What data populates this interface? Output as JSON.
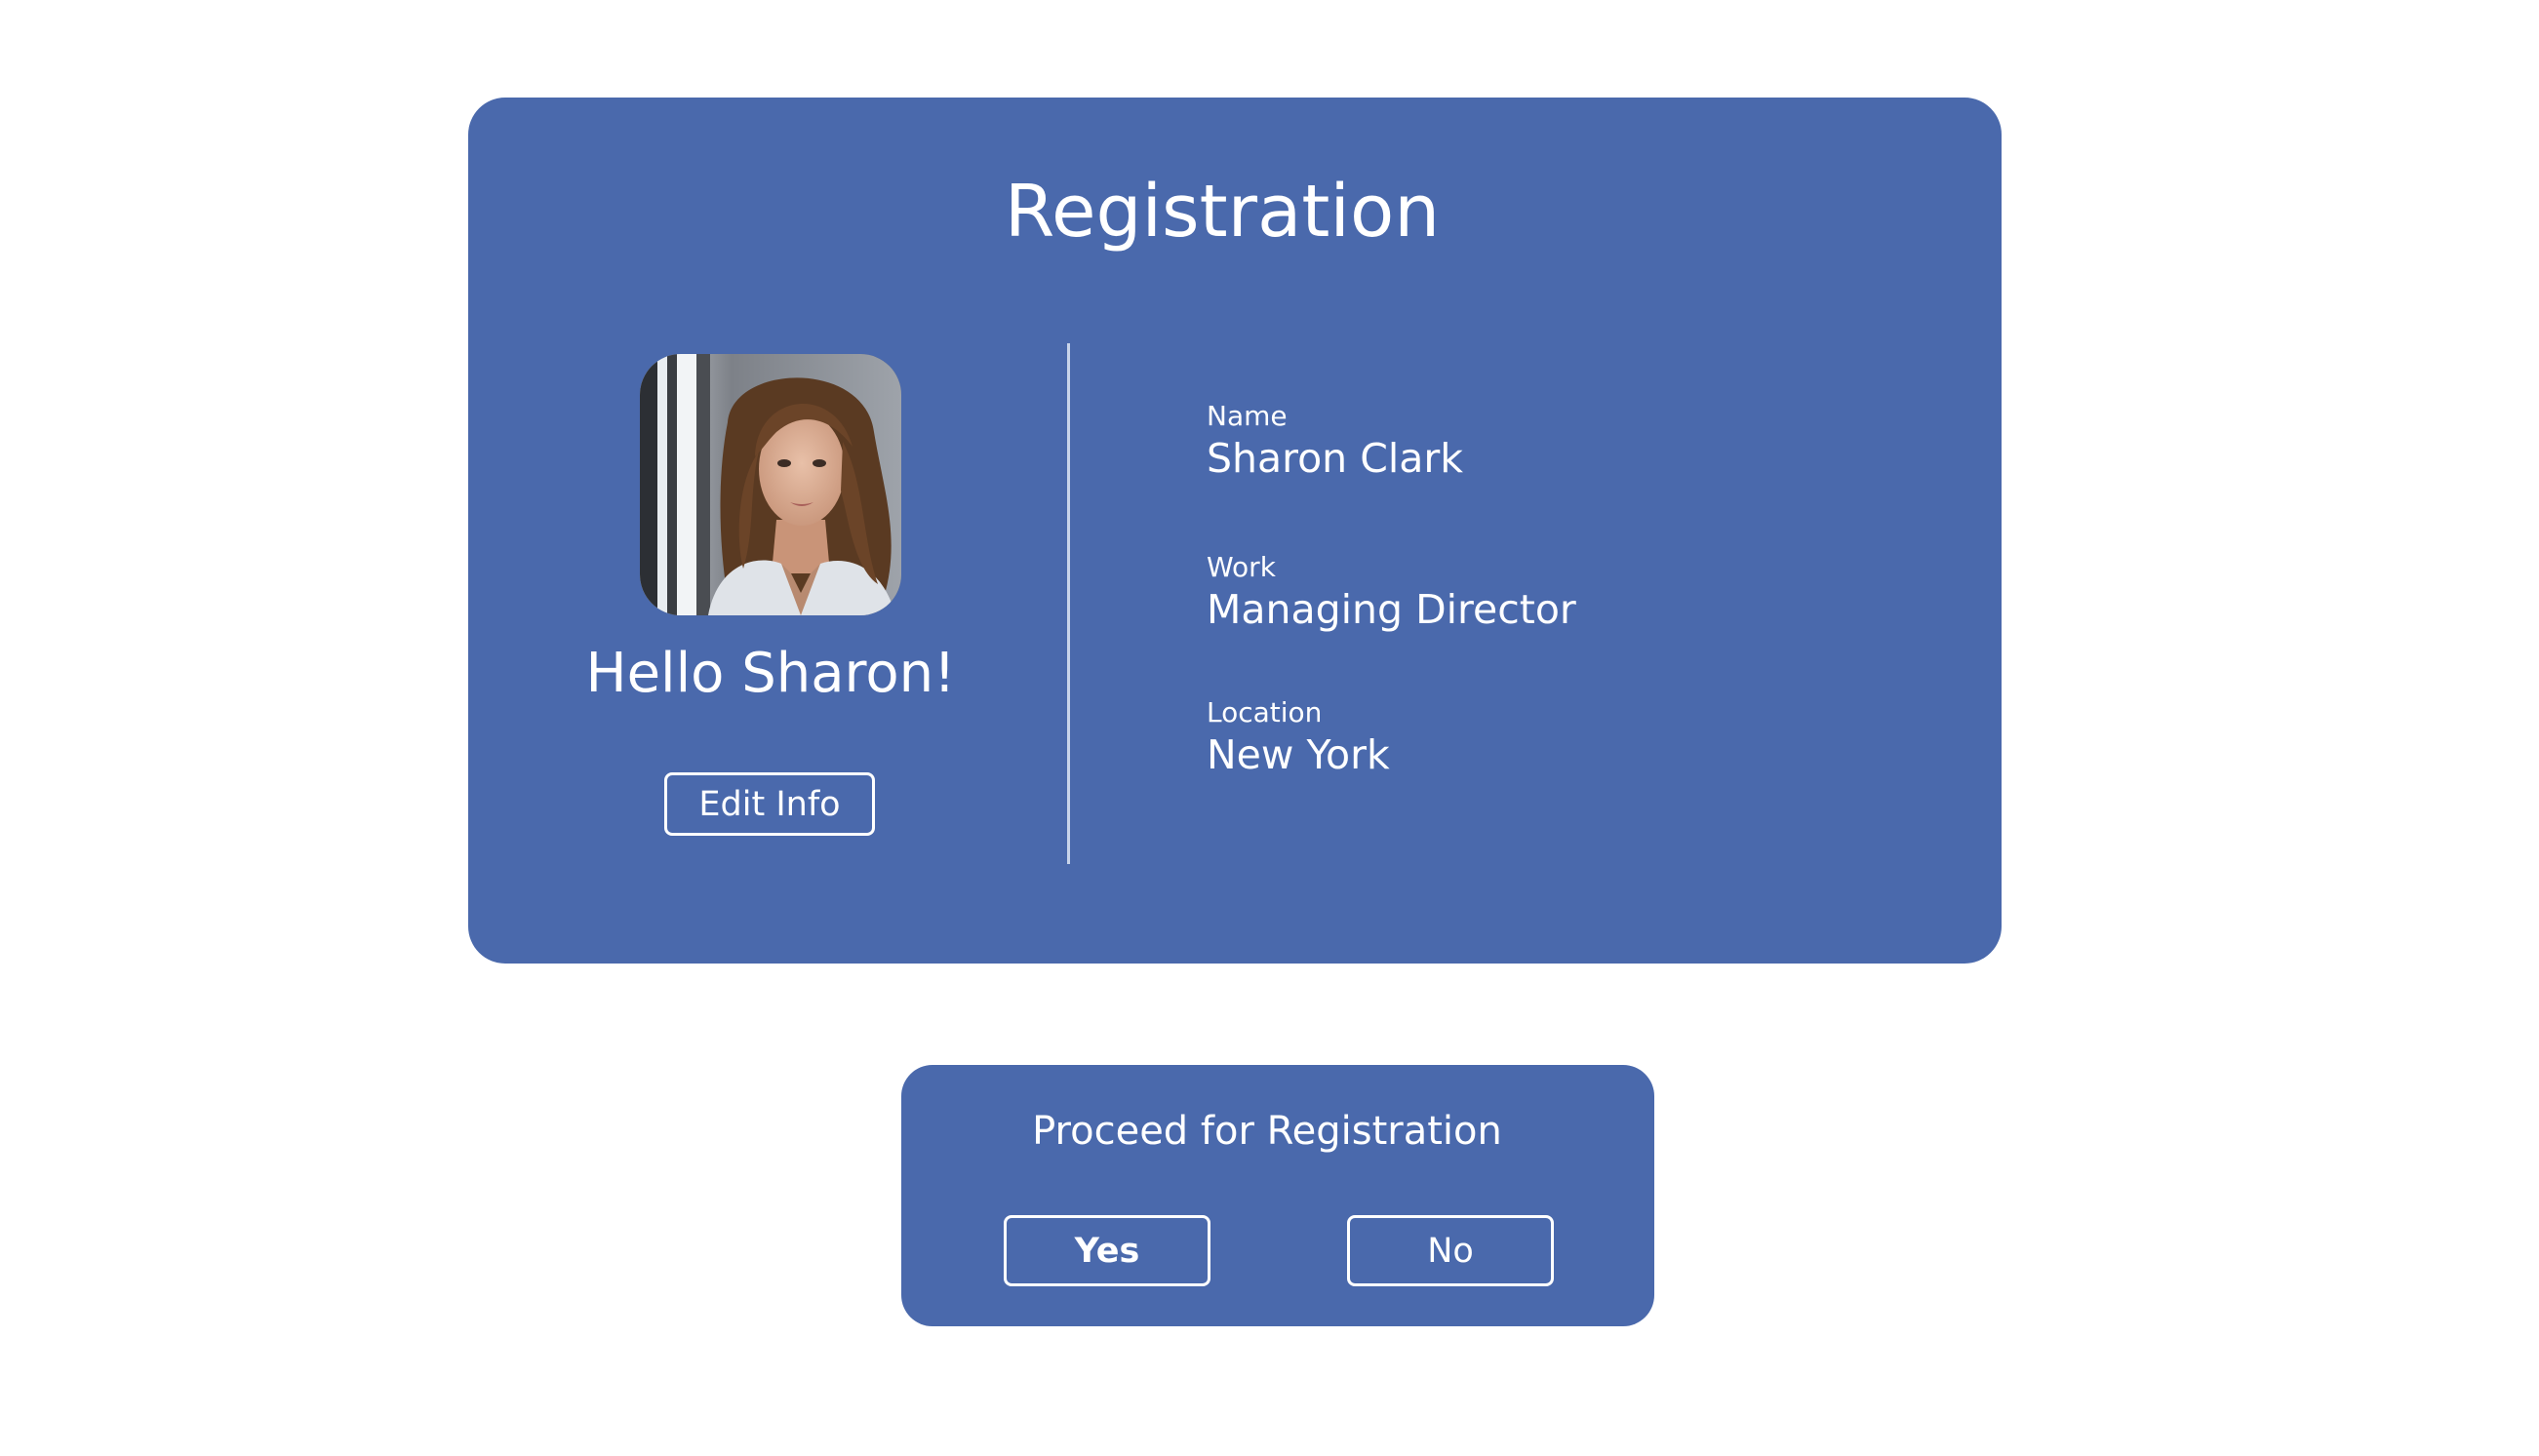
{
  "colors": {
    "card_background": "#4a69ac",
    "text": "#ffffff",
    "page_background": "#ffffff"
  },
  "registration": {
    "title": "Registration",
    "avatar_icon": "profile-photo",
    "greeting": "Hello Sharon!",
    "edit_button_label": "Edit Info",
    "fields": {
      "name": {
        "label": "Name",
        "value": "Sharon Clark"
      },
      "work": {
        "label": "Work",
        "value": "Managing Director"
      },
      "location": {
        "label": "Location",
        "value": "New York"
      }
    }
  },
  "proceed_dialog": {
    "title": "Proceed for Registration",
    "yes_label": "Yes",
    "no_label": "No"
  }
}
